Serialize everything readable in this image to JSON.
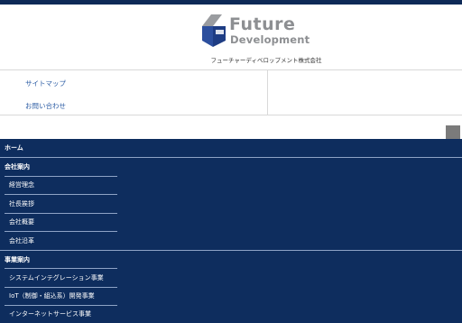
{
  "header": {
    "logo": {
      "word_future": "Future",
      "word_development": "Development",
      "icon": "future-development-logo-icon",
      "colors": {
        "blue": "#2c4f9e",
        "gray": "#8d8f92"
      }
    },
    "company_name": "フューチャーディベロップメント株式会社"
  },
  "utility_nav": {
    "sitemap": "サイトマップ",
    "contact": "お問い合わせ"
  },
  "menu_toggle": {
    "icon": "menu-toggle-icon"
  },
  "main_nav": {
    "home": "ホーム",
    "company": {
      "label": "会社案内",
      "items": [
        "経営理念",
        "社長挨拶",
        "会社概要",
        "会社沿革"
      ]
    },
    "business": {
      "label": "事業案内",
      "items": [
        "システムインテグレーション事業",
        "IoT（制御・組込系）開発事業",
        "インターネットサービス事業"
      ]
    }
  },
  "colors": {
    "top_bar": "#0e2a57",
    "nav_background": "#0e2d5e",
    "link": "#2e5ea5",
    "toggle": "#7b7b7b"
  }
}
